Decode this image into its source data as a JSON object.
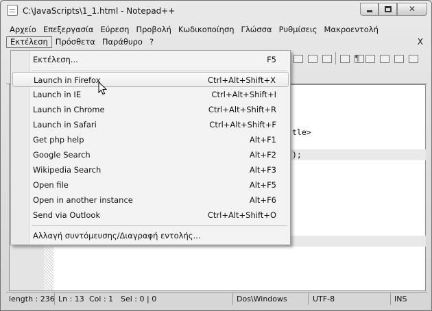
{
  "window": {
    "title": "C:\\JavaScripts\\1_1.html - Notepad++",
    "close_glyph": "✕"
  },
  "menubar": {
    "row1": [
      "Αρχείο",
      "Επεξεργασία",
      "Εύρεση",
      "Προβολή",
      "Κωδικοποίηση",
      "Γλώσσα",
      "Ρυθμίσεις",
      "Μακροεντολή"
    ],
    "row2": [
      "Εκτέλεση",
      "Πρόσθετα",
      "Παράθυρο",
      "?"
    ],
    "close": "X"
  },
  "toolbar": {
    "pilcrow": "¶"
  },
  "editor": {
    "visible_code": [
      "tle>",
      ");"
    ]
  },
  "run_menu": {
    "run_item": {
      "label": "Εκτέλεση...",
      "shortcut": "F5"
    },
    "items": [
      {
        "label": "Launch in Firefox",
        "shortcut": "Ctrl+Alt+Shift+X"
      },
      {
        "label": "Launch in IE",
        "shortcut": "Ctrl+Alt+Shift+I"
      },
      {
        "label": "Launch in Chrome",
        "shortcut": "Ctrl+Alt+Shift+R"
      },
      {
        "label": "Launch in Safari",
        "shortcut": "Ctrl+Alt+Shift+F"
      },
      {
        "label": "Get php help",
        "shortcut": "Alt+F1"
      },
      {
        "label": "Google Search",
        "shortcut": "Alt+F2"
      },
      {
        "label": "Wikipedia Search",
        "shortcut": "Alt+F3"
      },
      {
        "label": "Open file",
        "shortcut": "Alt+F5"
      },
      {
        "label": "Open in another instance",
        "shortcut": "Alt+F6"
      },
      {
        "label": "Send via Outlook",
        "shortcut": "Ctrl+Alt+Shift+O"
      }
    ],
    "modify_item": {
      "label": "Αλλαγή συντόμευσης/Διαγραφή εντολής..."
    }
  },
  "statusbar": {
    "length": "length : 236",
    "ln": "Ln : 13",
    "col": "Col : 1",
    "sel": "Sel : 0 | 0",
    "eol": "Dos\\Windows",
    "encoding": "UTF-8",
    "mode": "INS"
  }
}
